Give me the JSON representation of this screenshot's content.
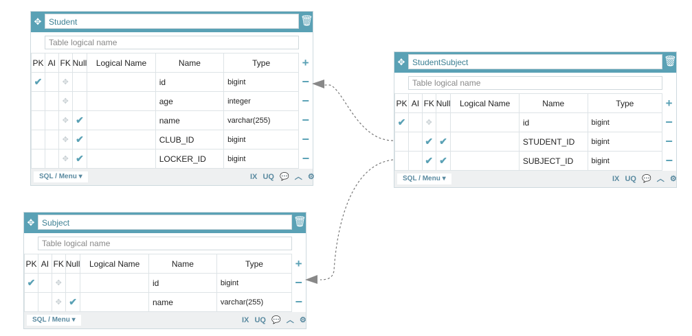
{
  "columns_header": {
    "pk": "PK",
    "ai": "AI",
    "fk": "FK",
    "null": "Null",
    "logical": "Logical Name",
    "name": "Name",
    "type": "Type"
  },
  "logical_placeholder": "Table logical name",
  "footer": {
    "menu": "SQL / Menu ▾",
    "ix": "IX",
    "uq": "UQ"
  },
  "icons": {
    "move": "move-icon",
    "trash": "trash-icon",
    "add": "plus-icon",
    "remove": "minus-icon",
    "check": "check-icon",
    "comment": "comment-icon",
    "collapse": "chevron-up-icon",
    "settings": "gear-icon"
  },
  "colors": {
    "accent": "#5aa1b5",
    "footer": "#eef0f1",
    "border": "#cdd9de"
  },
  "tables": {
    "student": {
      "name": "Student",
      "columns": [
        {
          "name": "id",
          "type": "bigint"
        },
        {
          "name": "age",
          "type": "integer"
        },
        {
          "name": "name",
          "type": "varchar(255)"
        },
        {
          "name": "CLUB_ID",
          "type": "bigint"
        },
        {
          "name": "LOCKER_ID",
          "type": "bigint"
        }
      ]
    },
    "student_subject": {
      "name": "StudentSubject",
      "columns": [
        {
          "name": "id",
          "type": "bigint"
        },
        {
          "name": "STUDENT_ID",
          "type": "bigint"
        },
        {
          "name": "SUBJECT_ID",
          "type": "bigint"
        }
      ]
    },
    "subject": {
      "name": "Subject",
      "columns": [
        {
          "name": "id",
          "type": "bigint"
        },
        {
          "name": "name",
          "type": "varchar(255)"
        }
      ]
    }
  }
}
